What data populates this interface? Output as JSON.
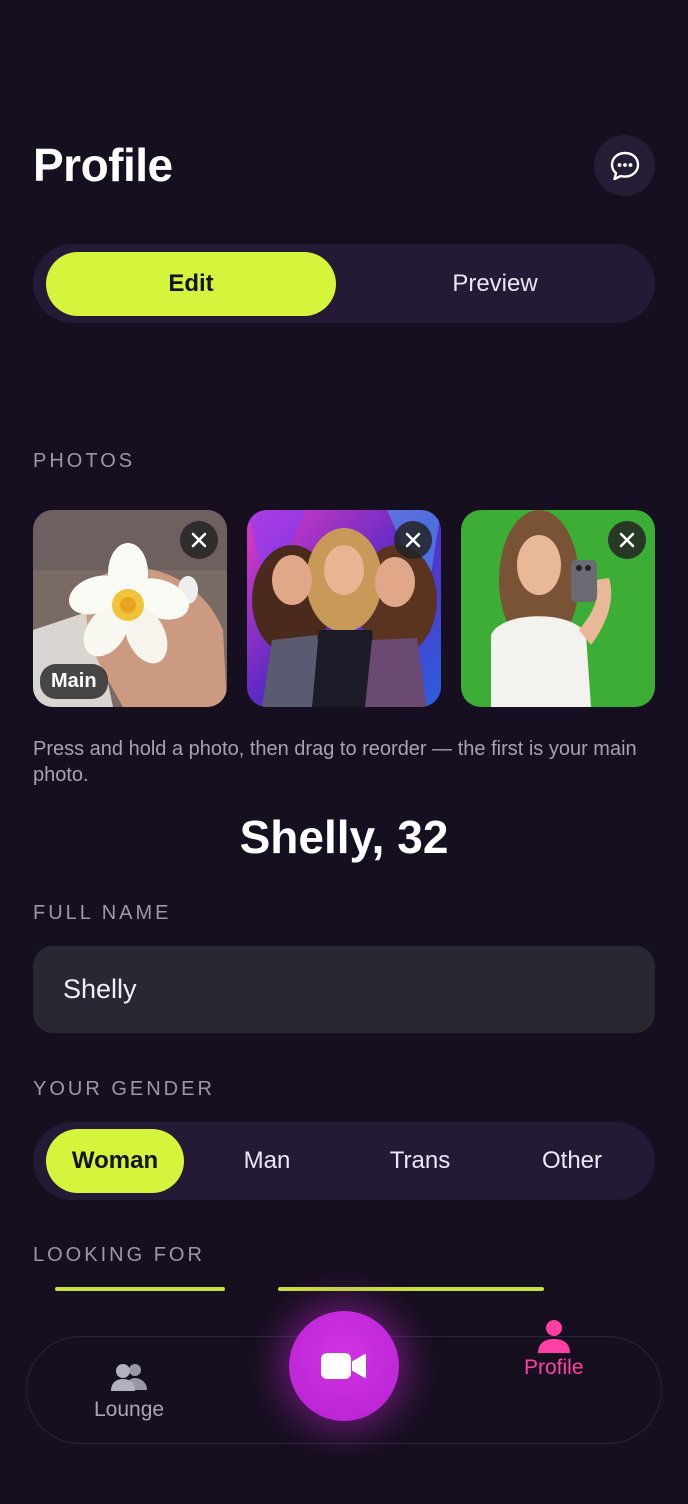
{
  "header": {
    "title": "Profile",
    "chat_icon": "chat-bubble-icon"
  },
  "mode_toggle": {
    "options": [
      "Edit",
      "Preview"
    ],
    "selected": "Edit"
  },
  "photos": {
    "label": "PHOTOS",
    "items": [
      {
        "description": "white flower photo",
        "main": true,
        "main_label": "Main"
      },
      {
        "description": "three women at party photo",
        "main": false
      },
      {
        "description": "woman selfie green background photo",
        "main": false
      }
    ],
    "hint": "Press and hold a photo, then drag to reorder — the first is your main photo."
  },
  "profile": {
    "name_age": "Shelly, 32"
  },
  "full_name": {
    "label": "FULL NAME",
    "value": "Shelly"
  },
  "gender": {
    "label": "YOUR GENDER",
    "options": [
      "Woman",
      "Man",
      "Trans",
      "Other"
    ],
    "selected": "Woman"
  },
  "looking_for": {
    "label": "LOOKING FOR"
  },
  "nav": {
    "lounge_label": "Lounge",
    "profile_label": "Profile",
    "video_icon": "video-camera-icon"
  },
  "colors": {
    "accent": "#d4f53c",
    "background": "#150f1f",
    "nav_active": "#ff3fa4",
    "fab": "#c42bd8"
  }
}
